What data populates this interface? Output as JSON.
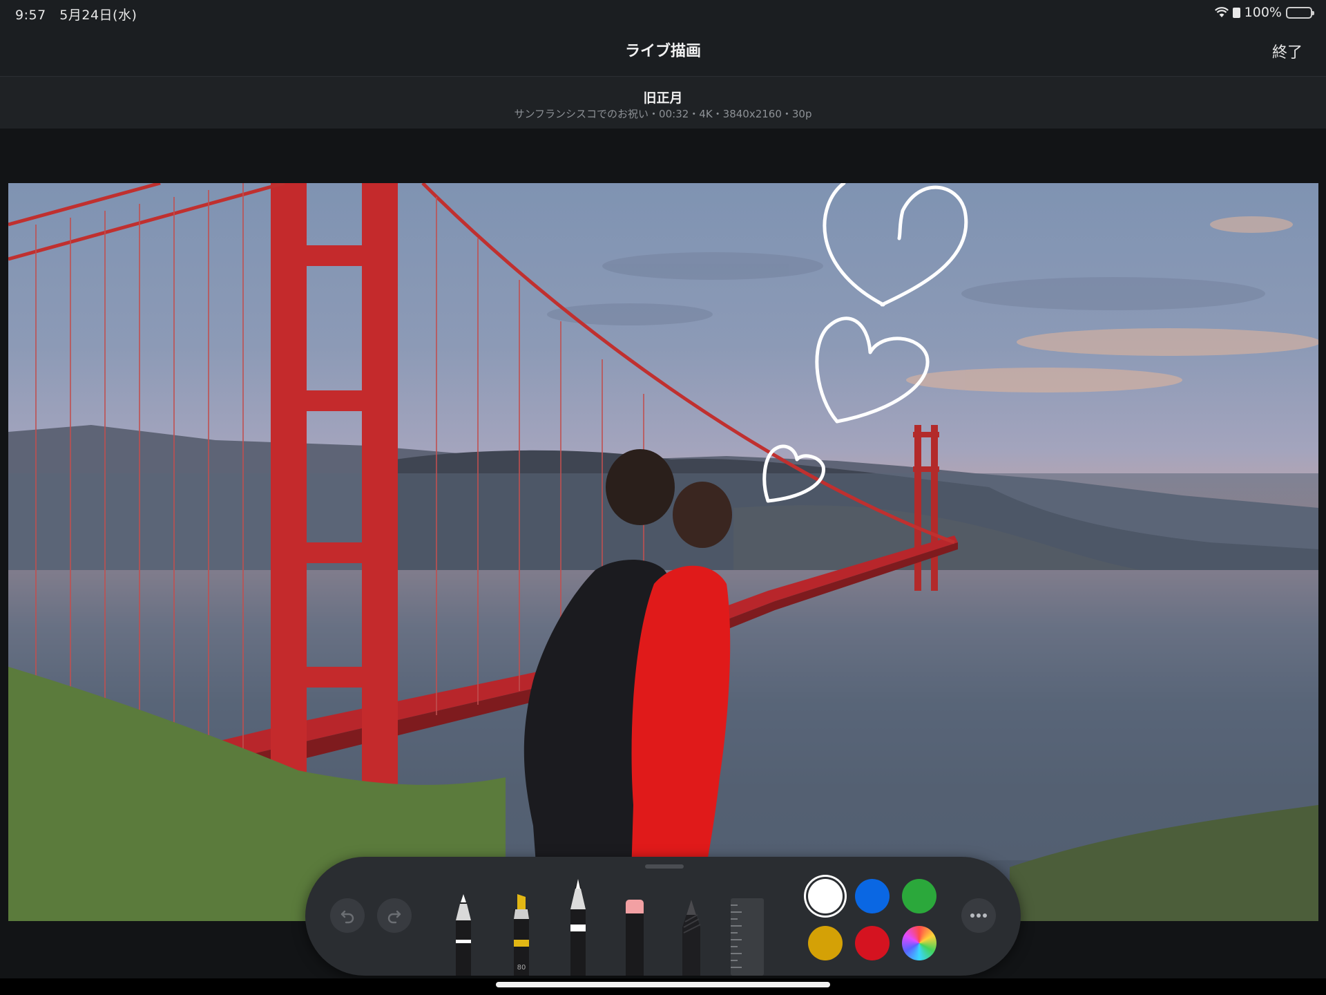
{
  "status_bar": {
    "time": "9:57",
    "date": "5月24日(水)",
    "battery": "100%",
    "icons": [
      "wifi-icon",
      "lock-rotation-icon",
      "battery-icon"
    ]
  },
  "nav": {
    "title": "ライブ描画",
    "done_label": "終了"
  },
  "video": {
    "title": "旧正月",
    "meta": "サンフランシスコでのお祝い・00:32・4K・3840x2160・30p"
  },
  "palette": {
    "undo_icon": "undo-icon",
    "redo_icon": "redo-icon",
    "tools": [
      {
        "name": "pen",
        "icon": "pen-tool-icon"
      },
      {
        "name": "highlighter",
        "icon": "highlighter-tool-icon",
        "label": "80"
      },
      {
        "name": "monoline",
        "icon": "monoline-pen-icon"
      },
      {
        "name": "eraser",
        "icon": "eraser-icon"
      },
      {
        "name": "pencil",
        "icon": "pencil-tool-icon"
      },
      {
        "name": "ruler",
        "icon": "ruler-icon"
      }
    ],
    "colors": [
      {
        "name": "white",
        "hex": "#ffffff",
        "selected": true
      },
      {
        "name": "blue",
        "hex": "#0a67e3"
      },
      {
        "name": "green",
        "hex": "#2ba83b"
      },
      {
        "name": "yellow",
        "hex": "#d4a106"
      },
      {
        "name": "red",
        "hex": "#d51320"
      },
      {
        "name": "multicolor",
        "hex": "conic"
      }
    ],
    "more_icon": "ellipsis-icon"
  }
}
